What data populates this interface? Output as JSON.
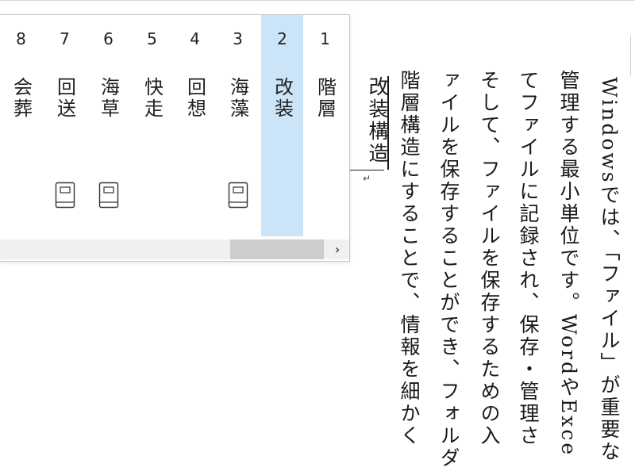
{
  "document": {
    "columns": [
      "Windowsでは、「ファイル」が重要な",
      "管理する最小単位です。WordやExce",
      "てファイルに記録され、保存・管理さ",
      "そして、ファイルを保存するための入",
      "ァイルを保存することができ、フォルダ",
      "階層構造にすることで、情報を細かく"
    ],
    "composition": "改装構造"
  },
  "candidate_window": {
    "candidates": [
      {
        "num": "8",
        "word": "会葬",
        "dict_icon": false
      },
      {
        "num": "7",
        "word": "回送",
        "dict_icon": true
      },
      {
        "num": "6",
        "word": "海草",
        "dict_icon": true
      },
      {
        "num": "5",
        "word": "快走",
        "dict_icon": false
      },
      {
        "num": "4",
        "word": "回想",
        "dict_icon": false
      },
      {
        "num": "3",
        "word": "海藻",
        "dict_icon": true
      },
      {
        "num": "2",
        "word": "改装",
        "dict_icon": false,
        "selected": true
      },
      {
        "num": "1",
        "word": "階層",
        "dict_icon": false
      }
    ],
    "scroll_right_icon": "chevron-right-icon",
    "selected_color": "#cce4f7"
  }
}
